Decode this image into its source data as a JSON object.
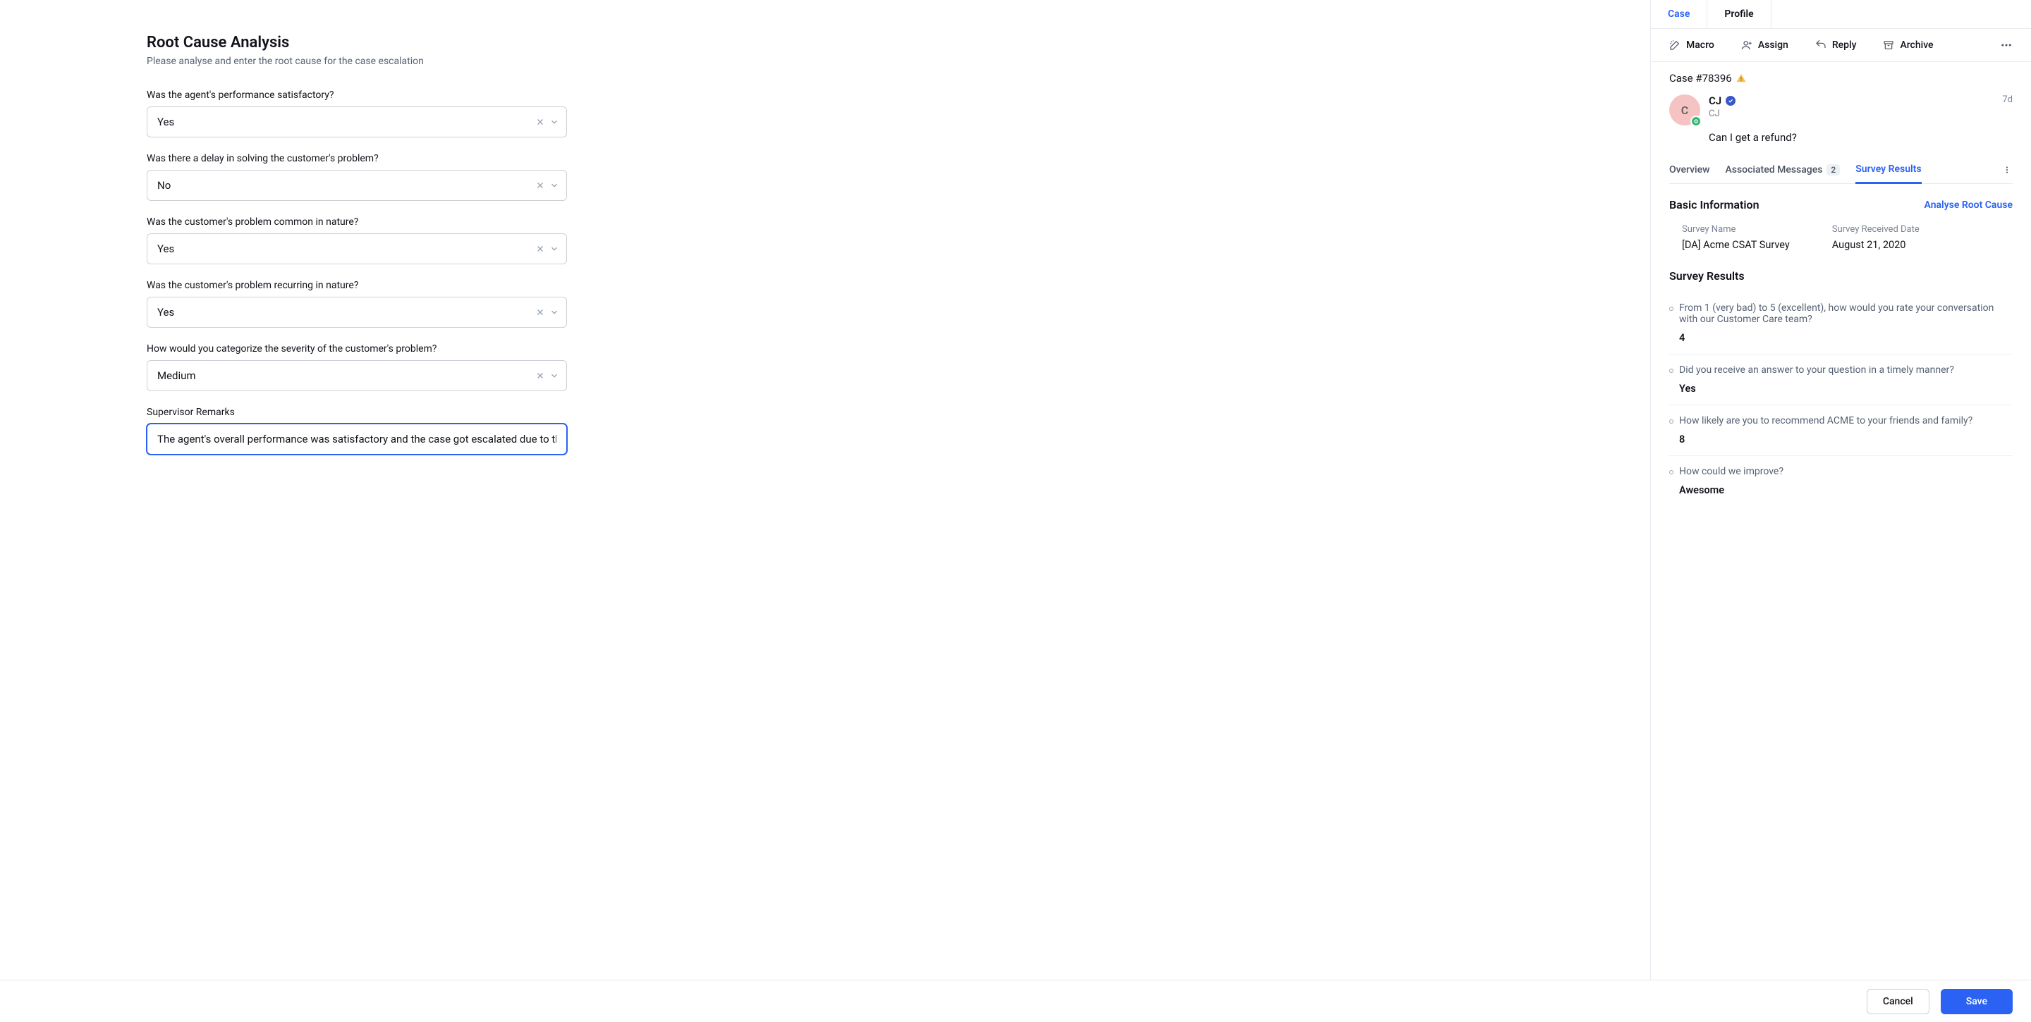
{
  "form": {
    "title": "Root Cause Analysis",
    "subtitle": "Please analyse and enter the root cause for the case escalation",
    "fields": [
      {
        "label": "Was the agent's performance satisfactory?",
        "value": "Yes"
      },
      {
        "label": "Was there a delay in solving the customer's problem?",
        "value": "No"
      },
      {
        "label": "Was the customer's problem common in nature?",
        "value": "Yes"
      },
      {
        "label": "Was the customer's problem recurring in nature?",
        "value": "Yes"
      },
      {
        "label": "How would you categorize the severity of the customer's problem?",
        "value": "Medium"
      }
    ],
    "remarksLabel": "Supervisor Remarks",
    "remarksValue": "The agent's overall performance was satisfactory and the case got escalated due to the"
  },
  "inspector": {
    "topTabs": {
      "case": "Case",
      "profile": "Profile"
    },
    "actions": {
      "macro": "Macro",
      "assign": "Assign",
      "reply": "Reply",
      "archive": "Archive"
    },
    "caseId": "Case #78396",
    "person": {
      "initial": "C",
      "name": "CJ",
      "sub": "CJ",
      "time": "7d"
    },
    "subject": "Can I get a refund?",
    "subTabs": {
      "overview": "Overview",
      "assocMsgs": "Associated Messages",
      "assocCount": "2",
      "survey": "Survey Results"
    },
    "basicInfoTitle": "Basic Information",
    "analyseLink": "Analyse Root Cause",
    "surveyNameLabel": "Survey Name",
    "surveyNameValue": "[DA] Acme CSAT Survey",
    "surveyDateLabel": "Survey Received Date",
    "surveyDateValue": "August 21, 2020",
    "surveyResultsTitle": "Survey Results",
    "surveyItems": [
      {
        "q": "From 1 (very bad) to 5 (excellent), how would you rate your conversation with our Customer Care team?",
        "a": "4"
      },
      {
        "q": "Did you receive an answer to your question in a timely manner?",
        "a": "Yes"
      },
      {
        "q": "How likely are you to recommend ACME to your friends and family?",
        "a": "8"
      },
      {
        "q": "How could we improve?",
        "a": "Awesome"
      }
    ]
  },
  "footer": {
    "cancel": "Cancel",
    "save": "Save"
  }
}
